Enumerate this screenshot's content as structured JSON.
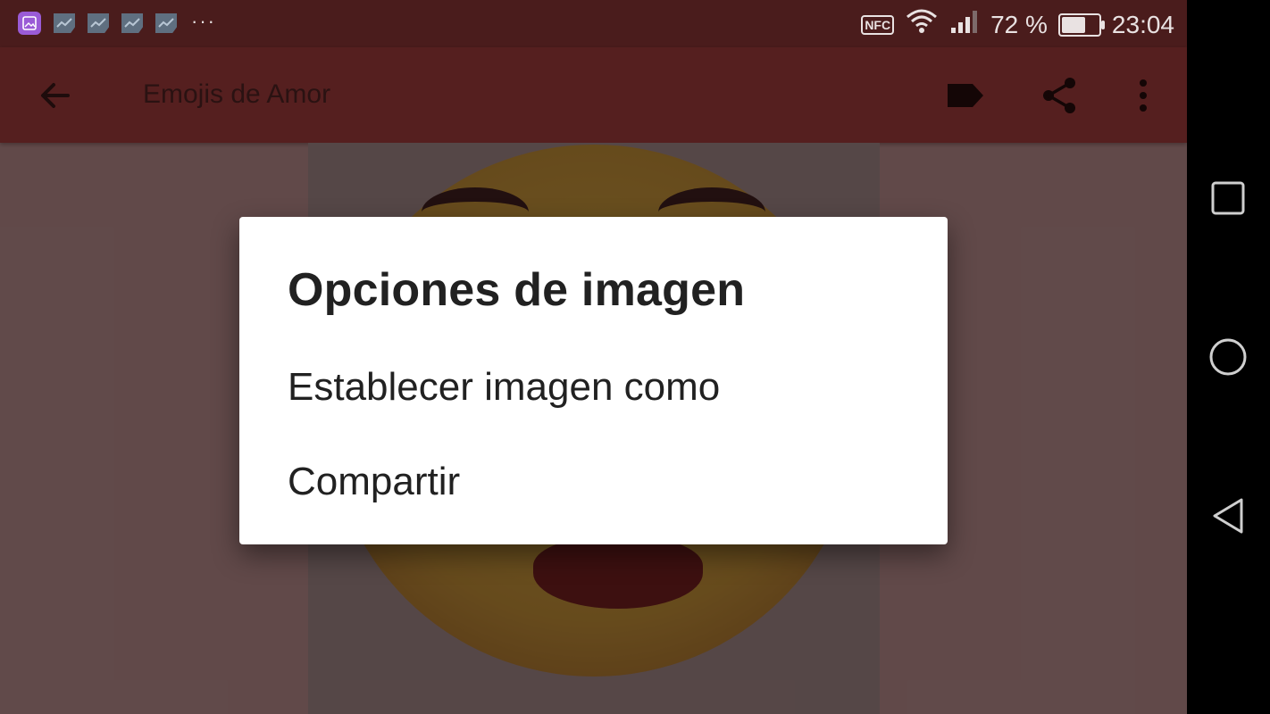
{
  "status_bar": {
    "notification_icons": [
      "gallery-app-icon",
      "chart-icon",
      "chart-icon",
      "chart-icon",
      "chart-icon"
    ],
    "overflow": "···",
    "nfc": "NFC",
    "battery_percent_text": "72 %",
    "battery_level": 0.72,
    "time": "23:04"
  },
  "app_bar": {
    "title": "Emojis de Amor",
    "icons": [
      "back-arrow-icon",
      "label-icon",
      "share-icon",
      "more-vert-icon"
    ]
  },
  "dialog": {
    "title": "Opciones de imagen",
    "items": [
      "Establecer imagen como",
      "Compartir"
    ]
  },
  "nav_bar": {
    "icons": [
      "recents-square-icon",
      "home-circle-icon",
      "back-triangle-icon"
    ]
  },
  "colors": {
    "status_bar": "#4a1c1c",
    "app_bar": "#551f1f",
    "dialog_bg": "#ffffff",
    "nav_bar": "#000000"
  }
}
